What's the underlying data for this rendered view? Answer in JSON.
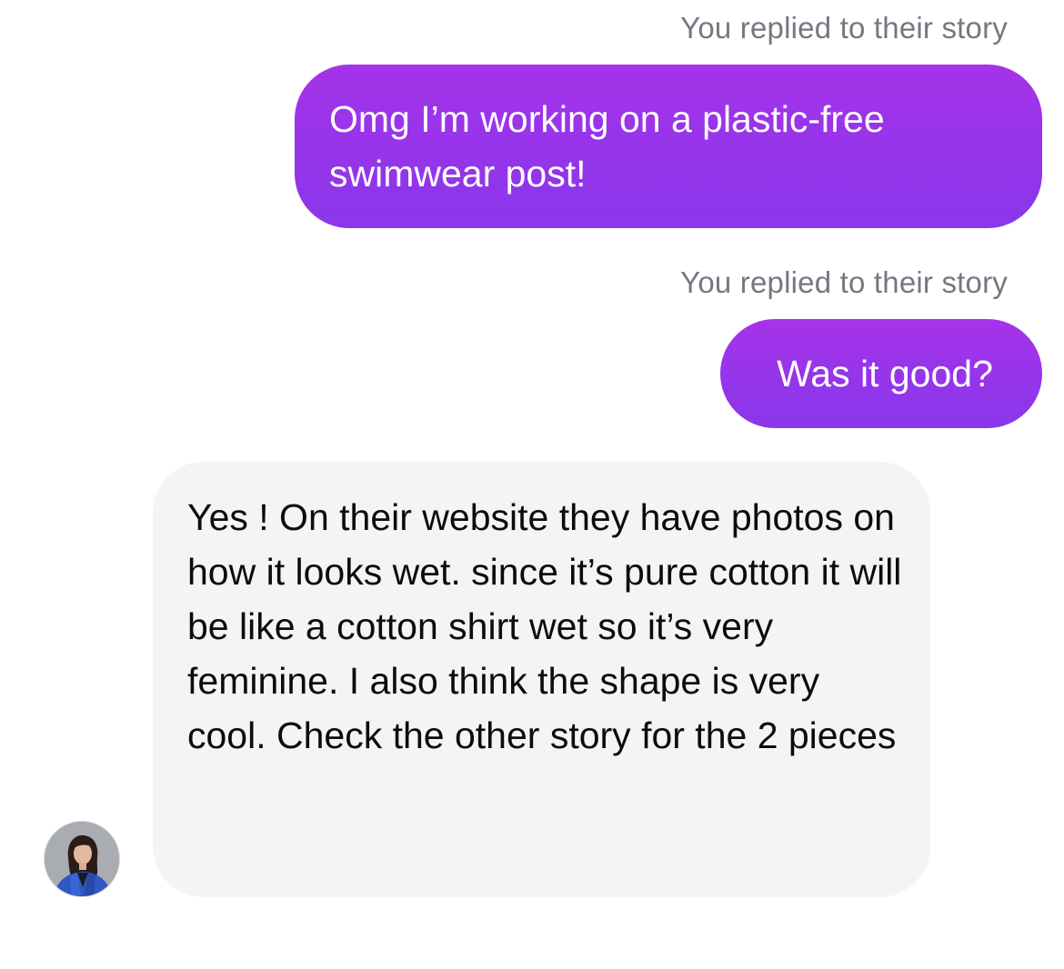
{
  "thread": {
    "messages": [
      {
        "sender": "me",
        "context_label": "You replied to their story",
        "text": "Omg I’m working on a plastic-free swimwear post!"
      },
      {
        "sender": "me",
        "context_label": "You replied to their story",
        "text": "Was it good?"
      },
      {
        "sender": "them",
        "text": "Yes ! On their website they have photos on how it looks wet. since it’s pure cotton it will be like a cotton shirt wet so it’s very feminine. I also think the shape is very cool. Check the other story for the 2 pieces"
      }
    ],
    "colors": {
      "outgoing_bubble_top": "#a533e9",
      "outgoing_bubble_bottom": "#8a37ea",
      "incoming_bubble": "#f3f4f6",
      "meta_text": "#737980"
    },
    "avatar_icon": "profile-photo-avatar"
  }
}
